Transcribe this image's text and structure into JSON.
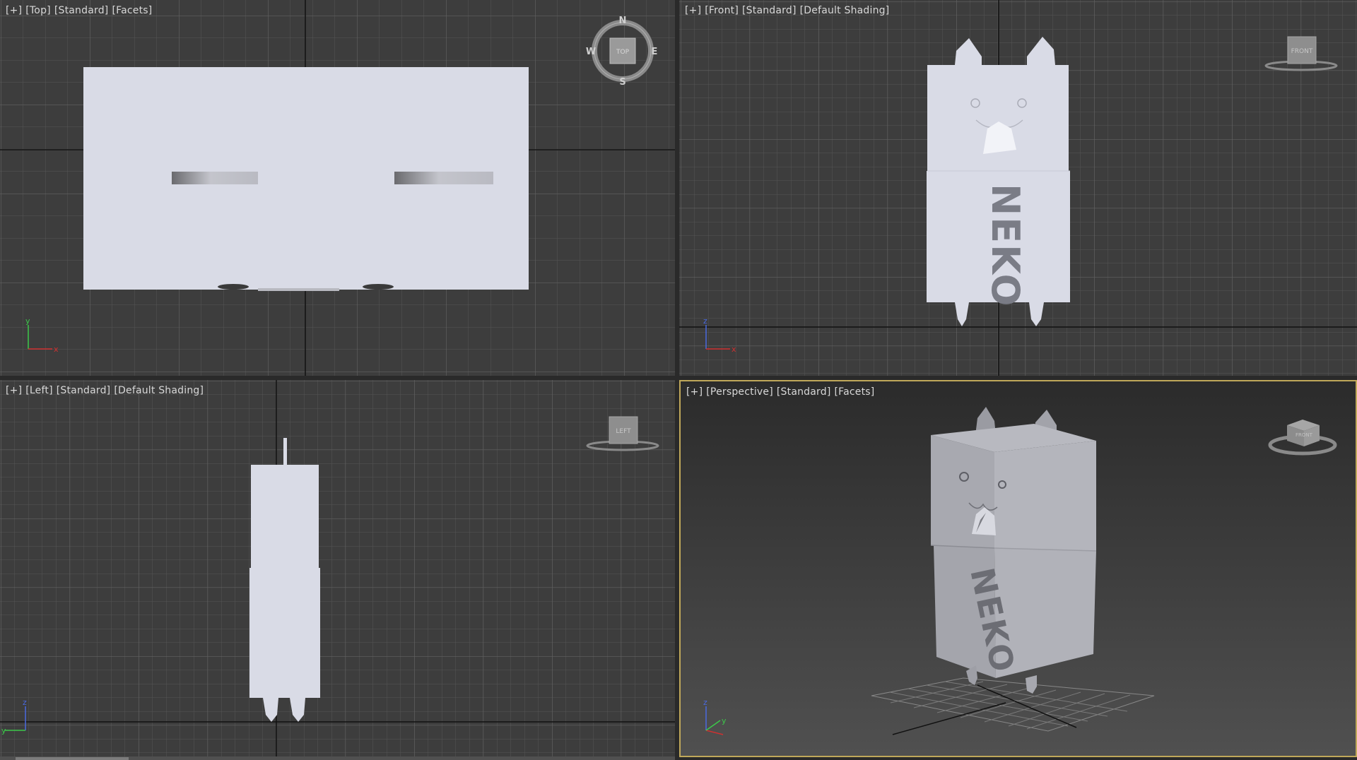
{
  "viewports": {
    "top": {
      "labels": [
        "[+]",
        "[Top]",
        "[Standard]",
        "[Facets]"
      ],
      "viewcube_text": "TOP",
      "compass": [
        "N",
        "E",
        "S",
        "W"
      ]
    },
    "front": {
      "labels": [
        "[+]",
        "[Front]",
        "[Standard]",
        "[Default Shading]"
      ],
      "viewcube_text": "FRONT"
    },
    "left": {
      "labels": [
        "[+]",
        "[Left]",
        "[Standard]",
        "[Default Shading]"
      ],
      "viewcube_text": "LEFT"
    },
    "perspective": {
      "labels": [
        "[+]",
        "[Perspective]",
        "[Standard]",
        "[Facets]"
      ],
      "viewcube_text": "FRONT"
    }
  },
  "model": {
    "text": "NEKO"
  },
  "axes": {
    "x": "x",
    "y": "y",
    "z": "z"
  },
  "colors": {
    "background": "#3d3d3d",
    "grid": "#5a5a5a",
    "model": "#d9dbe6",
    "active_border": "#c0a85a",
    "axis_x": "#d03030",
    "axis_y": "#3cc84a",
    "axis_z": "#4a6ae0"
  }
}
